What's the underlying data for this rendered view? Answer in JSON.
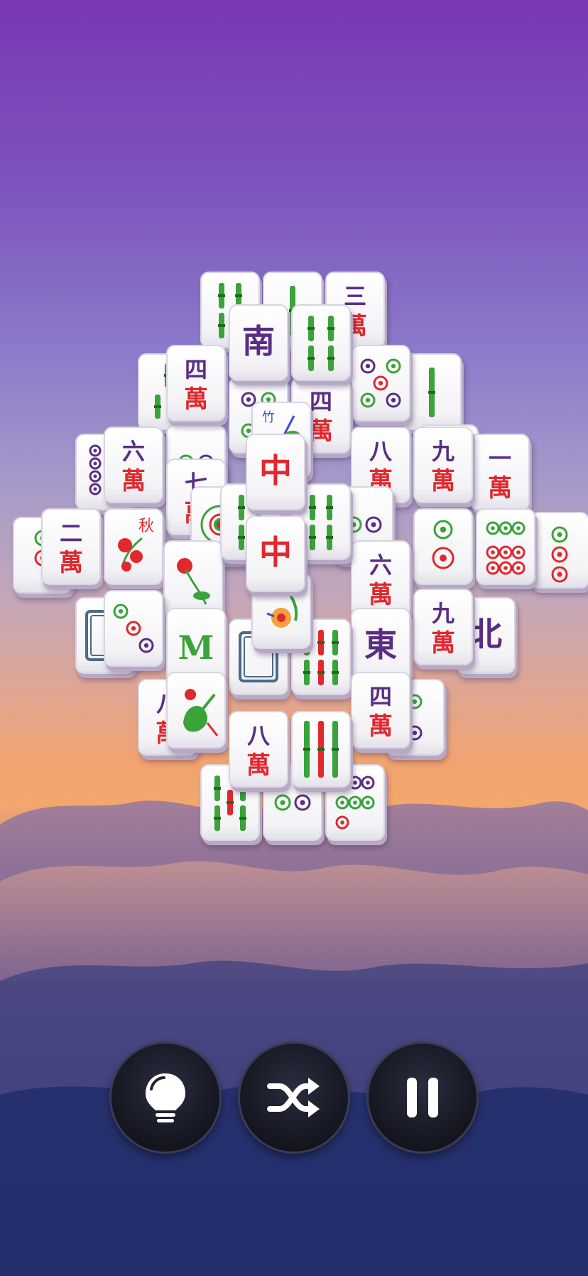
{
  "app": "Mahjong Solitaire",
  "palette": {
    "green": "#3aa33a",
    "red": "#e0282e",
    "blue": "#3a4fc4",
    "purple": "#5a2d82"
  },
  "tiles": [
    {
      "k": "bam2"
    },
    {
      "k": "bam1"
    },
    {
      "k": "char3",
      "a": "三",
      "b": "萬"
    },
    {
      "k": "bam3"
    },
    {
      "k": "bam1"
    },
    {
      "k": "wind",
      "a": "南"
    },
    {
      "k": "bam4"
    },
    {
      "k": "char4",
      "a": "四",
      "b": "萬"
    },
    {
      "k": "dots5"
    },
    {
      "k": "dots4"
    },
    {
      "k": "char4b",
      "a": "四",
      "b": "萬"
    },
    {
      "k": "dots2"
    },
    {
      "k": "char2",
      "a": "二",
      "b": "萬"
    },
    {
      "k": "dots8"
    },
    {
      "k": "char6",
      "a": "六",
      "b": "萬"
    },
    {
      "k": "char8",
      "a": "八",
      "b": "萬"
    },
    {
      "k": "char9",
      "a": "九",
      "b": "萬"
    },
    {
      "k": "char1",
      "a": "一",
      "b": "萬"
    },
    {
      "k": "bamboo-flower",
      "a": "竹"
    },
    {
      "k": "char7",
      "a": "七",
      "b": "萬"
    },
    {
      "k": "dots1"
    },
    {
      "k": "bam2"
    },
    {
      "k": "bam2"
    },
    {
      "k": "dots2"
    },
    {
      "k": "red",
      "a": "中"
    },
    {
      "k": "char2b",
      "a": "二",
      "b": "萬"
    },
    {
      "k": "autumn",
      "a": "秋"
    },
    {
      "k": "flower-red"
    },
    {
      "k": "dots5b"
    },
    {
      "k": "dots6"
    },
    {
      "k": "dots3b"
    },
    {
      "k": "dots3c"
    },
    {
      "k": "red",
      "a": "中"
    },
    {
      "k": "char6b",
      "a": "六",
      "b": "萬"
    },
    {
      "k": "char9b",
      "a": "九",
      "b": "萬"
    },
    {
      "k": "chrysanthemum"
    },
    {
      "k": "white"
    },
    {
      "k": "dots3"
    },
    {
      "k": "green",
      "a": "M"
    },
    {
      "k": "white"
    },
    {
      "k": "bam6"
    },
    {
      "k": "wind",
      "a": "東"
    },
    {
      "k": "wind",
      "a": "北"
    },
    {
      "k": "char8b",
      "a": "八",
      "b": "萬"
    },
    {
      "k": "bird"
    },
    {
      "k": "char4c",
      "a": "四",
      "b": "萬"
    },
    {
      "k": "dots2v"
    },
    {
      "k": "char8c",
      "a": "八",
      "b": "萬"
    },
    {
      "k": "bam9"
    },
    {
      "k": "bam5"
    },
    {
      "k": "dots2"
    },
    {
      "k": "dots8b"
    }
  ],
  "controls": {
    "hint": {
      "icon": "lightbulb-icon"
    },
    "shuffle": {
      "icon": "shuffle-icon"
    },
    "pause": {
      "icon": "pause-icon"
    }
  }
}
